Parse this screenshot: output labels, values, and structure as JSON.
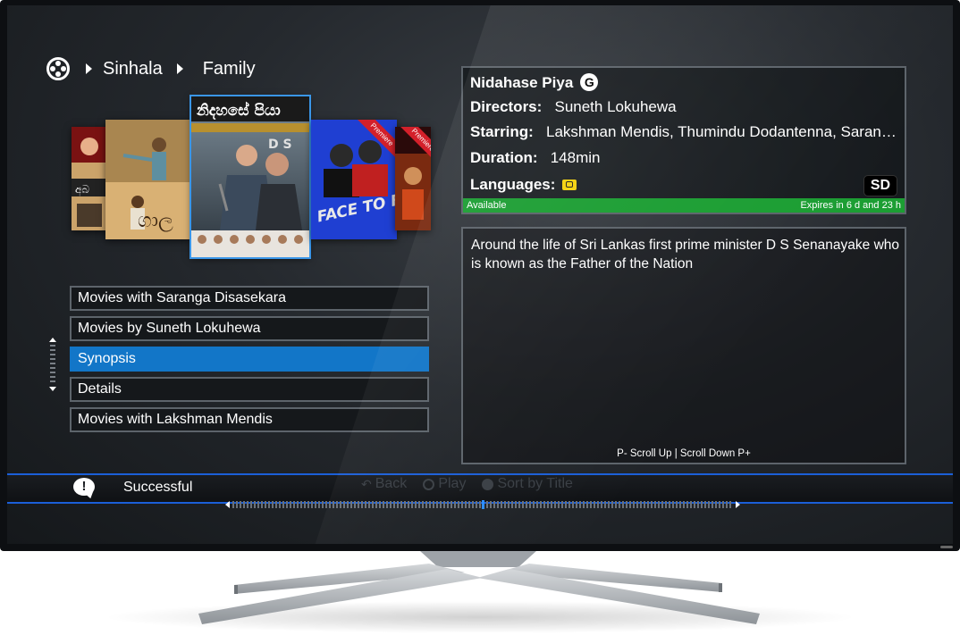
{
  "breadcrumb": {
    "icon": "film-reel-icon",
    "items": [
      "Sinhala",
      "Family"
    ]
  },
  "carousel": {
    "posters": [
      {
        "title": "",
        "ribbon": "",
        "colors": [
          "#7a1212",
          "#cfa25a"
        ]
      },
      {
        "title": "",
        "ribbon": "",
        "colors": [
          "#d9b174",
          "#8a5a2c"
        ]
      },
      {
        "title": "නිදහසේ පියා",
        "subtitle": "D S",
        "ribbon": "",
        "colors": [
          "#566a7c",
          "#2a333b"
        ],
        "selected": true
      },
      {
        "title": "FACE TO FACE",
        "ribbon": "Premiere",
        "colors": [
          "#1f3fd2",
          "#0a1a8a"
        ]
      },
      {
        "title": "",
        "ribbon": "Premiere",
        "colors": [
          "#2a0a0a",
          "#d0491b"
        ]
      }
    ]
  },
  "menu": {
    "items": [
      {
        "label": "Movies with Saranga Disasekara",
        "selected": false
      },
      {
        "label": "Movies by Suneth Lokuhewa",
        "selected": false
      },
      {
        "label": "Synopsis",
        "selected": true
      },
      {
        "label": "Details",
        "selected": false
      },
      {
        "label": "Movies with Lakshman Mendis",
        "selected": false
      }
    ]
  },
  "info": {
    "title": "Nidahase Piya",
    "rating": "G",
    "directors_label": "Directors:",
    "directors": "Suneth Lokuhewa",
    "starring_label": "Starring:",
    "starring": "Lakshman Mendis, Thumindu Dodantenna, Saran…",
    "duration_label": "Duration:",
    "duration": "148min",
    "languages_label": "Languages:",
    "languages_icon": "subtitle-lock-icon",
    "quality": "SD",
    "availability": "Available",
    "expires": "Expires in 6 d and 23 h"
  },
  "synopsis": {
    "text": "Around the life of Sri Lankas first prime minister D S Senanayake who is known as the Father of the Nation",
    "scroll_hint": "P- Scroll Up | Scroll Down P+"
  },
  "status": {
    "icon": "notification-bubble-icon",
    "text": "Successful",
    "hints": [
      {
        "icon": "back-arrow-icon",
        "label": "Back"
      },
      {
        "icon": "ok-button-icon",
        "label": "Play"
      },
      {
        "icon": "color-dot-icon",
        "label": "Sort by Title"
      }
    ]
  },
  "scrubber": {
    "position": 0.5
  },
  "colors": {
    "accent_blue": "#1276c8",
    "available_green": "#1c9e33",
    "status_border": "#1b5fd8",
    "premiere_red": "#d3202a",
    "language_yellow": "#f4d20e"
  }
}
